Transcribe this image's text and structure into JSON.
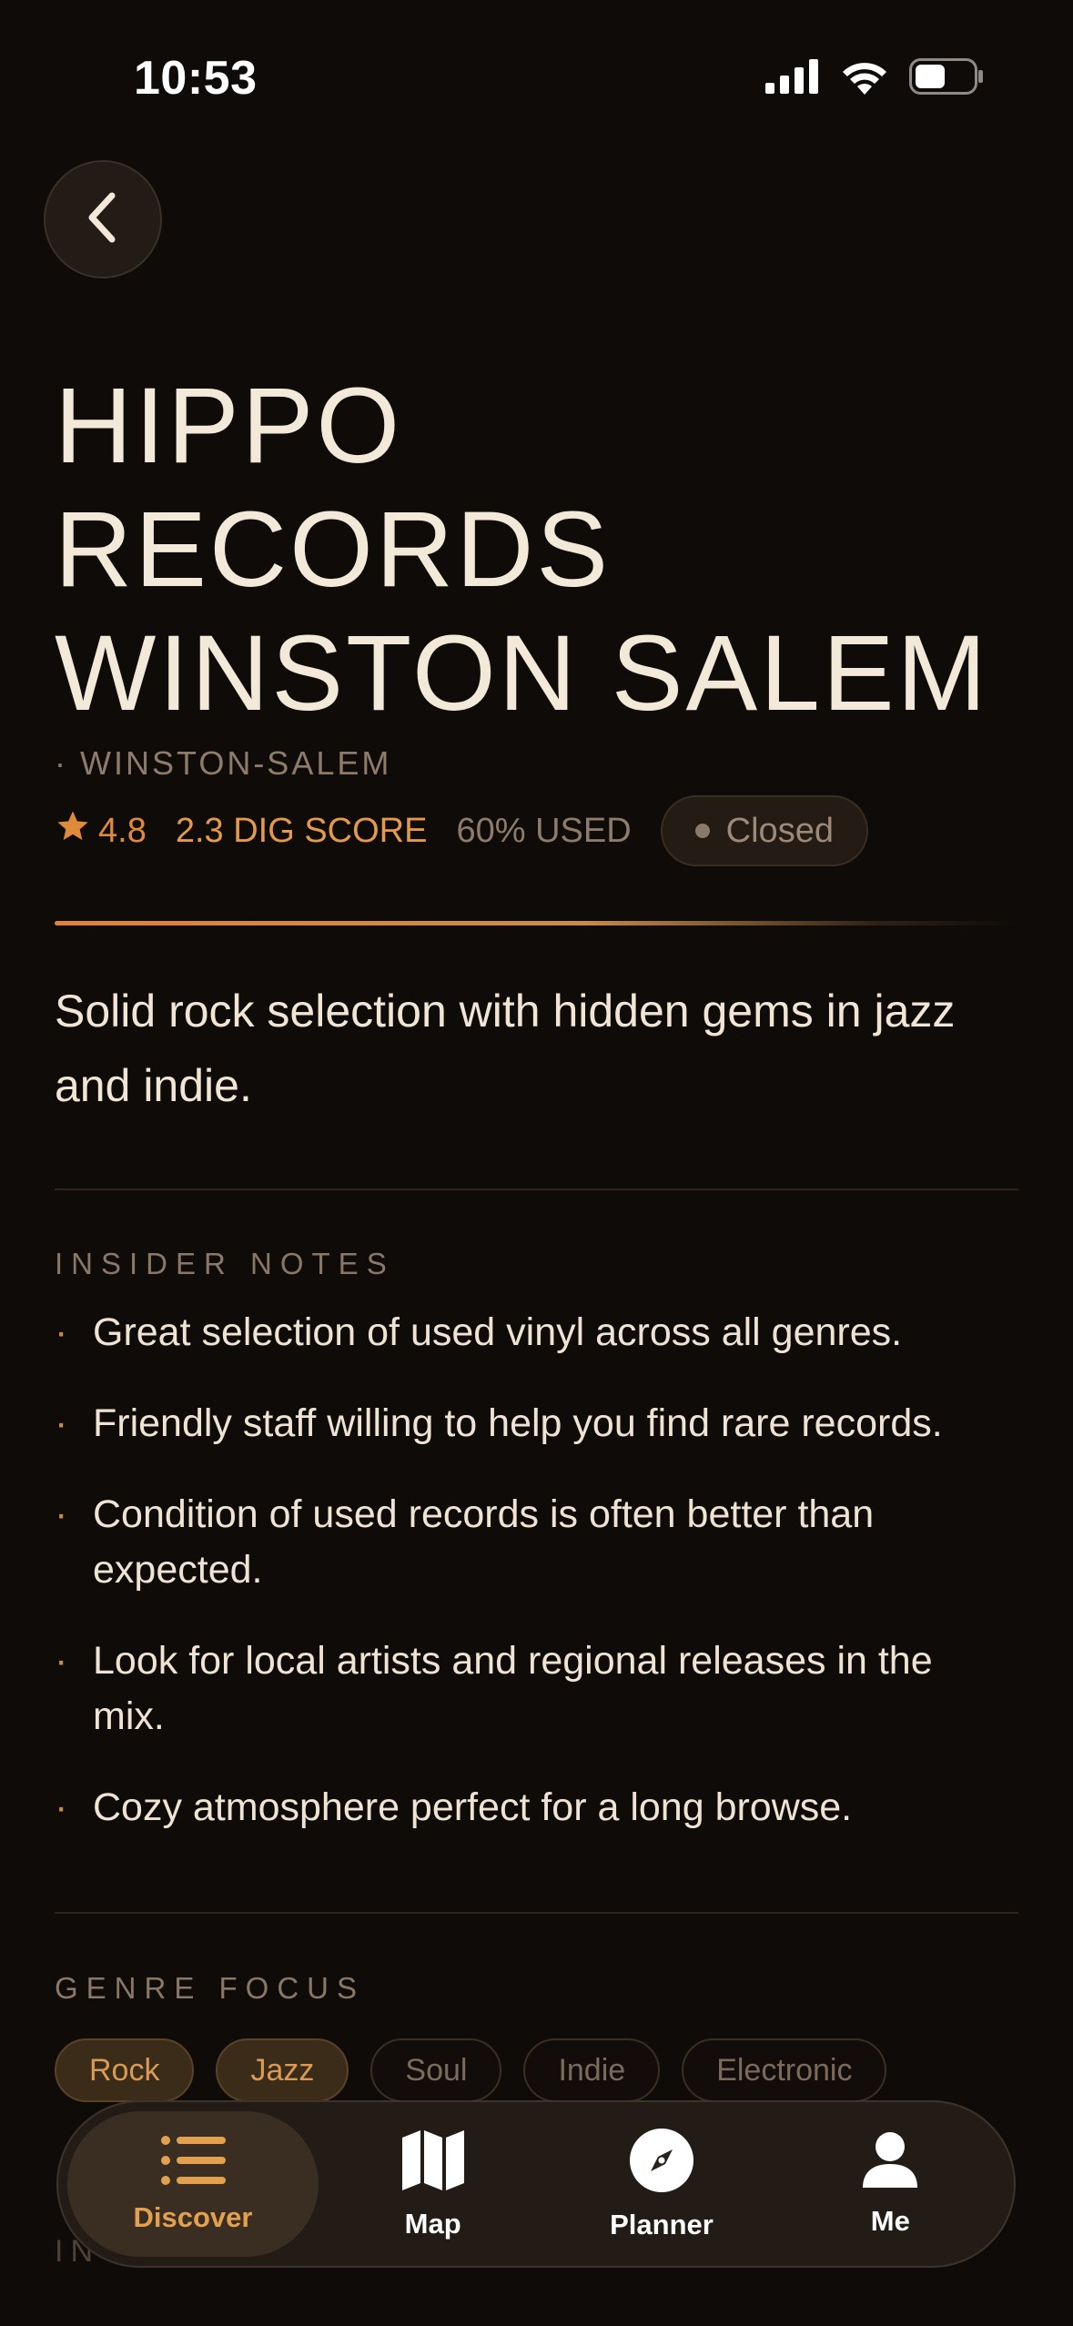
{
  "status_bar": {
    "time": "10:53"
  },
  "store": {
    "title_lines": [
      "HIPPO",
      "RECORDS",
      "WINSTON SALEM"
    ],
    "city": "· WINSTON-SALEM",
    "rating": "4.8",
    "dig_score": "2.3 DIG SCORE",
    "used_pct": "60% USED",
    "open_status": "Closed",
    "description": "Solid rock selection with hidden gems in jazz and indie."
  },
  "insider_notes": {
    "heading": "INSIDER NOTES",
    "bullet": "·",
    "items": [
      "Great selection of used vinyl across all genres.",
      "Friendly staff willing to help you find rare records.",
      "Condition of used records is often better than expected.",
      "Look for local artists and regional releases in the mix.",
      "Cozy atmosphere perfect for a long browse."
    ]
  },
  "genre_focus": {
    "heading": "GENRE FOCUS",
    "genres": [
      {
        "label": "Rock",
        "active": true
      },
      {
        "label": "Jazz",
        "active": true
      },
      {
        "label": "Soul",
        "active": false
      },
      {
        "label": "Indie",
        "active": false
      },
      {
        "label": "Electronic",
        "active": false
      }
    ]
  },
  "next_section_partial": "IN",
  "tab_bar": {
    "tabs": [
      {
        "label": "Discover",
        "icon": "list-icon",
        "active": true
      },
      {
        "label": "Map",
        "icon": "map-icon",
        "active": false
      },
      {
        "label": "Planner",
        "icon": "compass-icon",
        "active": false
      },
      {
        "label": "Me",
        "icon": "person-icon",
        "active": false
      }
    ]
  },
  "colors": {
    "background": "#0f0b08",
    "accent": "#e08a3c",
    "text": "#f1e6d6",
    "muted": "#8e7c6b"
  }
}
